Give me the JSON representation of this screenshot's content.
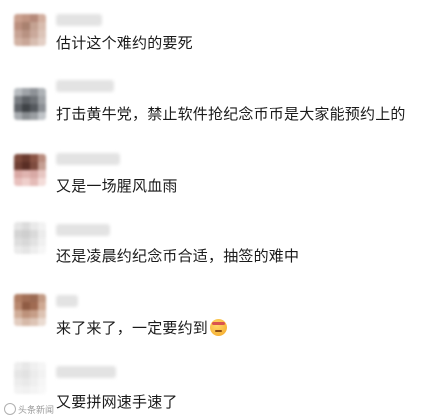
{
  "comments": [
    {
      "text": "估计这个难约的要死",
      "avatar": [
        "#caa08e",
        "#c19583",
        "#b5897a",
        "#d2ae9e",
        "#bb8f7e",
        "#a9816f",
        "#c4a292",
        "#d8bcae",
        "#c7a394",
        "#b89282",
        "#caa99b",
        "#dcc4b8",
        "#d2b2a3",
        "#c9a697",
        "#d7bdb0",
        "#e3cfc5"
      ]
    },
    {
      "text": "打击黄牛党，禁止软件抢纪念币币是大家能预约上的",
      "avatar": [
        "#b8bcc0",
        "#9fa3a8",
        "#8e9297",
        "#aeb2b6",
        "#7a7e83",
        "#5d6166",
        "#6e7277",
        "#9ea2a6",
        "#5f6368",
        "#3f4347",
        "#55595e",
        "#8c9095",
        "#a8acb0",
        "#8a8e92",
        "#9a9ea2",
        "#c0c4c8"
      ]
    },
    {
      "text": "又是一场腥风血雨",
      "avatar": [
        "#7d4a3c",
        "#6b3b2f",
        "#8a5445",
        "#b98c7e",
        "#6f3f33",
        "#5a2e25",
        "#7e4c3f",
        "#c59f93",
        "#d9a8a4",
        "#e0b4b0",
        "#d8a9a5",
        "#e7c6c2",
        "#e8c0bd",
        "#efcfcb",
        "#e4bbb7",
        "#f3dcd9"
      ]
    },
    {
      "text": "还是凌晨约纪念币合适，抽签的难中",
      "avatar": [
        "#e6e6e6",
        "#dcdcdc",
        "#e9e9e9",
        "#f2f2f2",
        "#d4d4d4",
        "#cfcfcf",
        "#dadada",
        "#ececec",
        "#dedede",
        "#d8d8d8",
        "#e2e2e2",
        "#f0f0f0",
        "#ebebeb",
        "#e5e5e5",
        "#eeeeee",
        "#f6f6f6"
      ]
    },
    {
      "text": "来了来了，一定要约到",
      "emoji_name": "face-with-thermometer-emoji",
      "avatar": [
        "#b07d63",
        "#a26f56",
        "#9b6a53",
        "#c29a84",
        "#b8876e",
        "#8f5c44",
        "#a06b52",
        "#cfa993",
        "#d0ad98",
        "#bd927b",
        "#c69e88",
        "#ddc3b3",
        "#e2ccbf",
        "#d6b9a8",
        "#ddc4b5",
        "#eadbd1"
      ]
    },
    {
      "text": "又要拼网速手速了",
      "avatar": [
        "#eeeeee",
        "#e8e8e8",
        "#f0f0f0",
        "#f5f5f5",
        "#e6e6e6",
        "#e2e2e2",
        "#ececec",
        "#f2f2f2",
        "#ededed",
        "#e9e9e9",
        "#efefef",
        "#f6f6f6",
        "#f3f3f3",
        "#f1f1f1",
        "#f4f4f4",
        "#f8f8f8"
      ]
    }
  ],
  "watermark": {
    "text": "头条新闻"
  }
}
